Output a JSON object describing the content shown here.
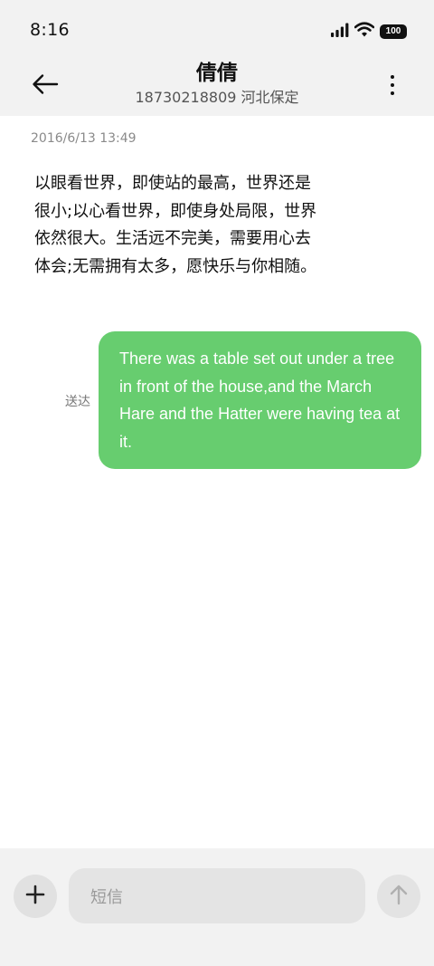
{
  "status_bar": {
    "time": "8:16",
    "battery": "100",
    "icons": [
      "signal-icon",
      "wifi-icon",
      "battery-icon"
    ]
  },
  "header": {
    "back_icon": "arrow-left-icon",
    "contact_name": "倩倩",
    "contact_detail": "18730218809 河北保定",
    "more_icon": "more-vertical-icon"
  },
  "conversation": {
    "timestamp": "2016/6/13 13:49",
    "incoming_message": "以眼看世界，即使站的最高，世界还是很小;以心看世界，即使身处局限，世界依然很大。生活远不完美，需要用心去体会;无需拥有太多，愿快乐与你相随。",
    "outgoing_message": "There was a table set out under a tree in front of the house,and the March Hare and the Hatter were having tea at it.",
    "delivery_status": "送达"
  },
  "composer": {
    "add_icon": "plus-icon",
    "placeholder": "短信",
    "send_icon": "arrow-up-icon"
  },
  "colors": {
    "bubble": "#67cd6f",
    "bar_background": "#f2f2f2",
    "page_background": "#ffffff"
  }
}
